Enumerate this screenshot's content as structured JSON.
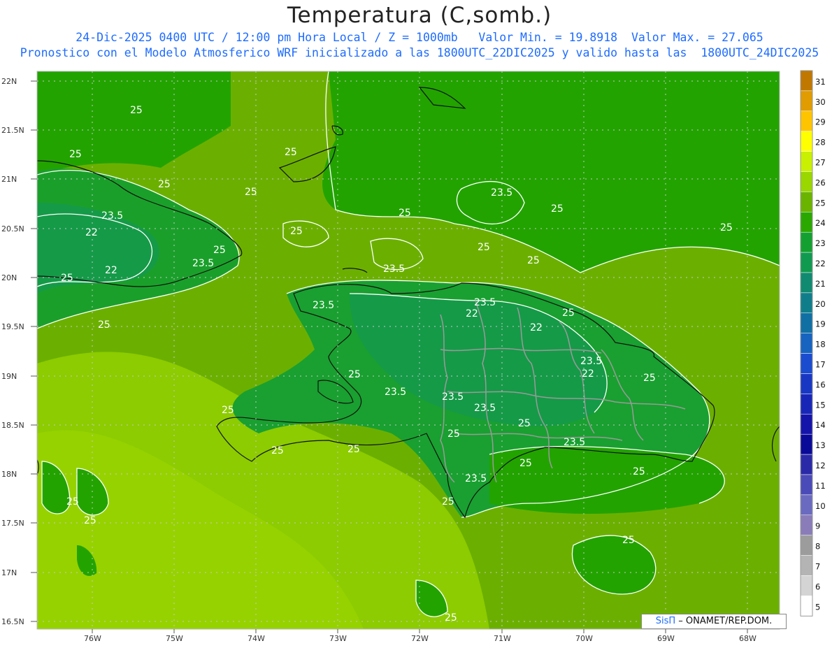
{
  "title": "Temperatura (C,somb.)",
  "subtitle_line1": "24-Dic-2025 0400 UTC / 12:00 pm Hora Local / Z = 1000mb   Valor Min. = 19.8918  Valor Max. = 27.065",
  "subtitle_line2": "Pronostico con el Modelo Atmosferico WRF inicializado a las 1800UTC_22DIC2025 y valido hasta las  1800UTC_24DIC2025",
  "credit": {
    "brand": "SisΠ",
    "text": " – ONAMET/REP.DOM."
  },
  "lat_labels": [
    "22N",
    "21.5N",
    "21N",
    "20.5N",
    "20N",
    "19.5N",
    "19N",
    "18.5N",
    "18N",
    "17.5N",
    "17N",
    "16.5N"
  ],
  "lon_labels": [
    "76W",
    "75W",
    "74W",
    "73W",
    "72W",
    "71W",
    "70W",
    "69W",
    "68W"
  ],
  "colorbar": {
    "labels": [
      "31",
      "30",
      "29",
      "28",
      "27",
      "26",
      "25",
      "24",
      "23",
      "22",
      "21",
      "20",
      "19",
      "18",
      "17",
      "16",
      "15",
      "14",
      "13",
      "12",
      "11",
      "10",
      "9",
      "8",
      "7",
      "6",
      "5"
    ],
    "colors": [
      "#c07800",
      "#e09c00",
      "#ffc400",
      "#ffff00",
      "#c8f000",
      "#9ad600",
      "#6ab400",
      "#2aa800",
      "#14a030",
      "#109a50",
      "#108a70",
      "#107e8a",
      "#1070a4",
      "#1664c0",
      "#1a4cd0",
      "#1838c4",
      "#1826b8",
      "#1414aa",
      "#0a0a98",
      "#2a2aa8",
      "#4a4ab8",
      "#6a6ac0",
      "#8a7cb8",
      "#9c9c9c",
      "#b4b4b4",
      "#d4d4d4",
      "#ffffff"
    ]
  },
  "contour_labels": [
    "25",
    "25",
    "25",
    "25",
    "25",
    "25",
    "23.5",
    "25",
    "25",
    "23.5",
    "22",
    "22",
    "25",
    "23.5",
    "25",
    "25",
    "25",
    "23.5",
    "25",
    "23.5",
    "25",
    "23.5",
    "22",
    "25",
    "22",
    "23.5",
    "22",
    "25",
    "23.5",
    "23.5",
    "25",
    "25",
    "23.5",
    "25",
    "23.5",
    "25",
    "23.5",
    "25",
    "25",
    "25",
    "25",
    "25",
    "25",
    "25",
    "25",
    "25"
  ]
}
